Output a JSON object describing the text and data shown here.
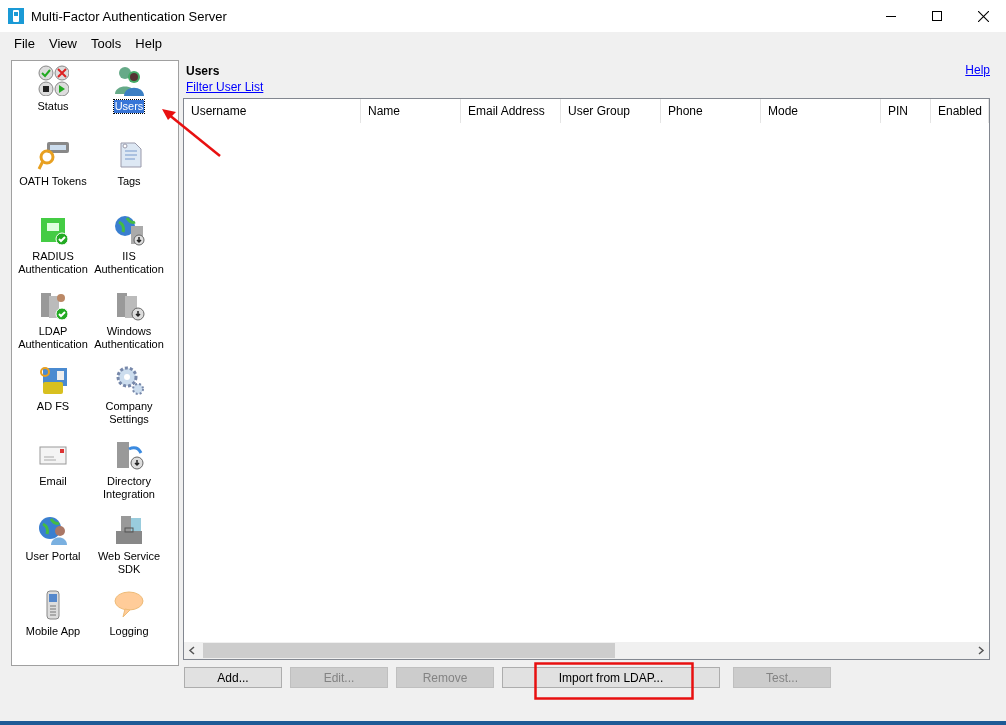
{
  "window": {
    "title": "Multi-Factor Authentication Server"
  },
  "menu": [
    "File",
    "View",
    "Tools",
    "Help"
  ],
  "sidebar": {
    "items": [
      {
        "label": "Status",
        "kind": "status",
        "selected": false
      },
      {
        "label": "Users",
        "kind": "users",
        "selected": true
      },
      {
        "label": "OATH Tokens",
        "kind": "key",
        "selected": false
      },
      {
        "label": "Tags",
        "kind": "tag",
        "selected": false
      },
      {
        "label": "RADIUS Authentication",
        "kind": "notebook",
        "selected": false
      },
      {
        "label": "IIS Authentication",
        "kind": "globeserver",
        "selected": false
      },
      {
        "label": "LDAP Authentication",
        "kind": "serveruser",
        "selected": false
      },
      {
        "label": "Windows Authentication",
        "kind": "server",
        "selected": false
      },
      {
        "label": "AD FS",
        "kind": "card",
        "selected": false
      },
      {
        "label": "Company Settings",
        "kind": "gears",
        "selected": false
      },
      {
        "label": "Email",
        "kind": "envelope",
        "selected": false
      },
      {
        "label": "Directory Integration",
        "kind": "serversync",
        "selected": false
      },
      {
        "label": "User Portal",
        "kind": "globeuser",
        "selected": false
      },
      {
        "label": "Web Service SDK",
        "kind": "toolbox",
        "selected": false
      },
      {
        "label": "Mobile App",
        "kind": "phone",
        "selected": false
      },
      {
        "label": "Logging",
        "kind": "bubble",
        "selected": false
      }
    ]
  },
  "panel": {
    "title": "Users",
    "help_link": "Help",
    "filter_link": "Filter User List"
  },
  "table": {
    "columns": [
      "Username",
      "Name",
      "Email Address",
      "User Group",
      "Phone",
      "Mode",
      "PIN",
      "Enabled"
    ]
  },
  "buttons": [
    {
      "label": "Add...",
      "disabled": false,
      "highlighted": false
    },
    {
      "label": "Edit...",
      "disabled": true,
      "highlighted": false
    },
    {
      "label": "Remove",
      "disabled": true,
      "highlighted": false
    },
    {
      "label": "Import from LDAP...",
      "disabled": false,
      "highlighted": true
    },
    {
      "label": "Test...",
      "disabled": true,
      "highlighted": false
    }
  ],
  "annotations": {
    "arrow_to_users": true
  }
}
